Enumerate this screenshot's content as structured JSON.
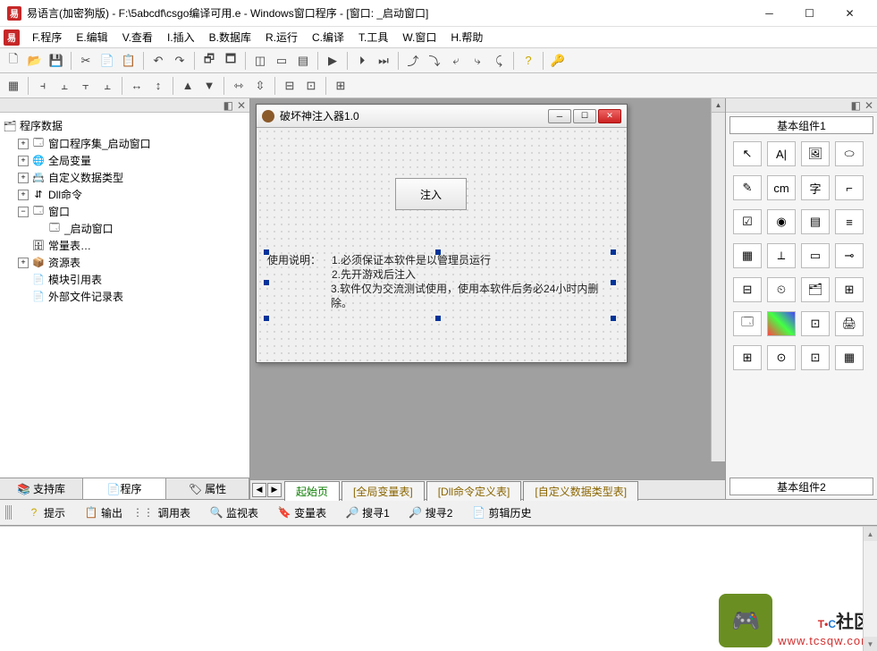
{
  "window": {
    "title": "易语言(加密狗版) - F:\\5abcdf\\csgo编译可用.e - Windows窗口程序 - [窗口: _启动窗口]"
  },
  "menu": {
    "items": [
      "F.程序",
      "E.编辑",
      "V.查看",
      "I.插入",
      "B.数据库",
      "R.运行",
      "C.编译",
      "T.工具",
      "W.窗口",
      "H.帮助"
    ]
  },
  "tree": {
    "header": "程序数据",
    "nodes": [
      {
        "toggle": "+",
        "icon": "🗔",
        "label": "窗口程序集_启动窗口",
        "indent": 1
      },
      {
        "toggle": "+",
        "icon": "🌐",
        "label": "全局变量",
        "indent": 1
      },
      {
        "toggle": "+",
        "icon": "📇",
        "label": "自定义数据类型",
        "indent": 1
      },
      {
        "toggle": "+",
        "icon": "⇵",
        "label": "Dll命令",
        "indent": 1
      },
      {
        "toggle": "−",
        "icon": "🗔",
        "label": "窗口",
        "indent": 1
      },
      {
        "toggle": "",
        "icon": "🗔",
        "label": "_启动窗口",
        "indent": 2
      },
      {
        "toggle": "",
        "icon": "🗄",
        "label": "常量表…",
        "indent": 1
      },
      {
        "toggle": "+",
        "icon": "📦",
        "label": "资源表",
        "indent": 1
      },
      {
        "toggle": "",
        "icon": "📄",
        "label": "模块引用表",
        "indent": 1
      },
      {
        "toggle": "",
        "icon": "📄",
        "label": "外部文件记录表",
        "indent": 1
      }
    ]
  },
  "left_tabs": [
    "支持库",
    "程序",
    "属性"
  ],
  "left_tabs_active": 1,
  "form": {
    "title": "破坏神注入器1.0",
    "button": "注入",
    "instructions_label": "使用说明：",
    "instructions": [
      "1.必须保证本软件是以管理员运行",
      "2.先开游戏后注入",
      "3.软件仅为交流测试使用，使用本软件后务必24小时内删除。"
    ]
  },
  "center_tabs": [
    "起始页",
    "[全局变量表]",
    "[Dll命令定义表]",
    "[自定义数据类型表]"
  ],
  "center_tabs_active": 0,
  "right": {
    "tab1": "基本组件1",
    "tab2": "基本组件2"
  },
  "bottom_tabs": [
    {
      "icon": "?",
      "label": "提示",
      "color": "#c9a800"
    },
    {
      "icon": "📋",
      "label": "输出",
      "color": "#555"
    },
    {
      "icon": "⋮⋮⋮",
      "label": "调用表",
      "color": "#555"
    },
    {
      "icon": "🔍",
      "label": "监视表",
      "color": "#555"
    },
    {
      "icon": "🔖",
      "label": "变量表",
      "color": "#b04db0"
    },
    {
      "icon": "🔎",
      "label": "搜寻1",
      "color": "#555"
    },
    {
      "icon": "🔎",
      "label": "搜寻2",
      "color": "#555"
    },
    {
      "icon": "📄",
      "label": "剪辑历史",
      "color": "#555"
    }
  ],
  "watermark": {
    "brand_t": "T",
    "brand_dot": "•",
    "brand_c": "C",
    "brand_suffix": "社区",
    "url": "www.tcsqw.com"
  }
}
